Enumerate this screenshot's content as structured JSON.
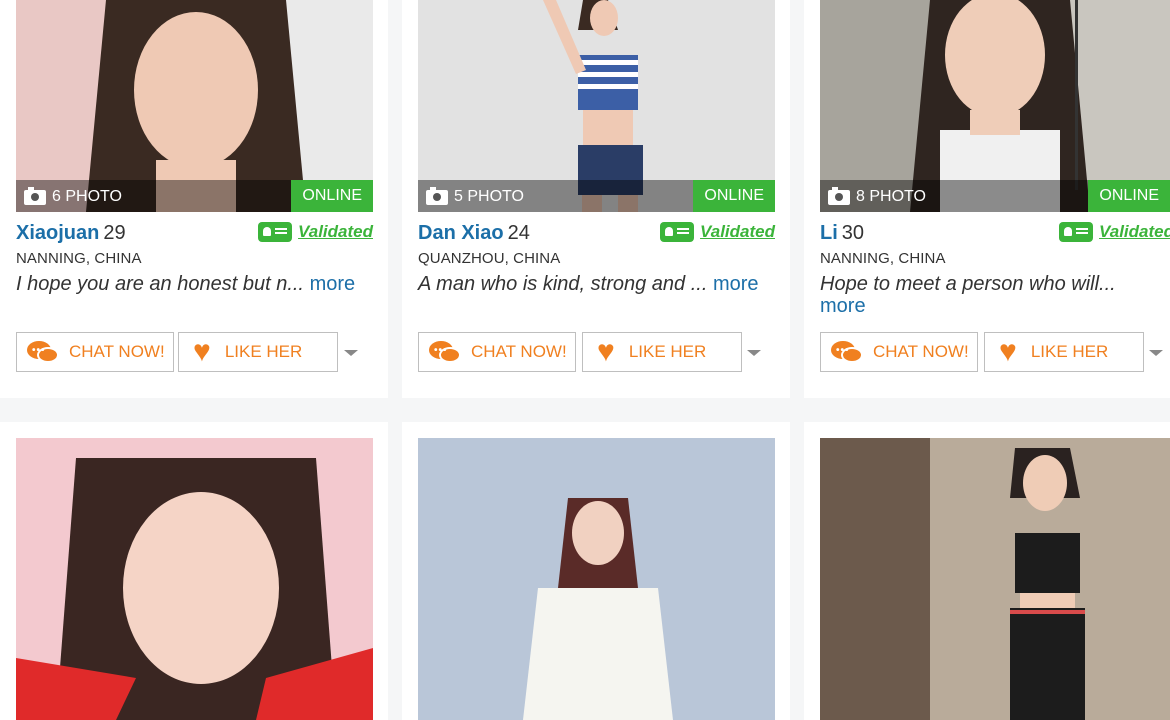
{
  "badges": {
    "online": "ONLINE",
    "validated": "Validated",
    "more": "more"
  },
  "buttons": {
    "chat": "CHAT NOW!",
    "like": "LIKE HER"
  },
  "profiles": [
    {
      "name": "Xiaojuan",
      "age": "29",
      "location": "NANNING, CHINA",
      "bio": "I hope you are an honest but n...",
      "photo_count": "6 PHOTO"
    },
    {
      "name": "Dan Xiao",
      "age": "24",
      "location": "QUANZHOU, CHINA",
      "bio": "A man who is kind, strong and ...",
      "photo_count": "5 PHOTO"
    },
    {
      "name": "Li",
      "age": "30",
      "location": "NANNING, CHINA",
      "bio": "Hope to meet a person who will...",
      "photo_count": "8 PHOTO"
    }
  ],
  "colors": {
    "online_green": "#3bb43a",
    "link_blue": "#1c6fa8",
    "accent_orange": "#f08020"
  },
  "icons": [
    "camera-icon",
    "validated-id-icon",
    "chat-bubbles-icon",
    "heart-icon",
    "chevron-down-icon"
  ]
}
